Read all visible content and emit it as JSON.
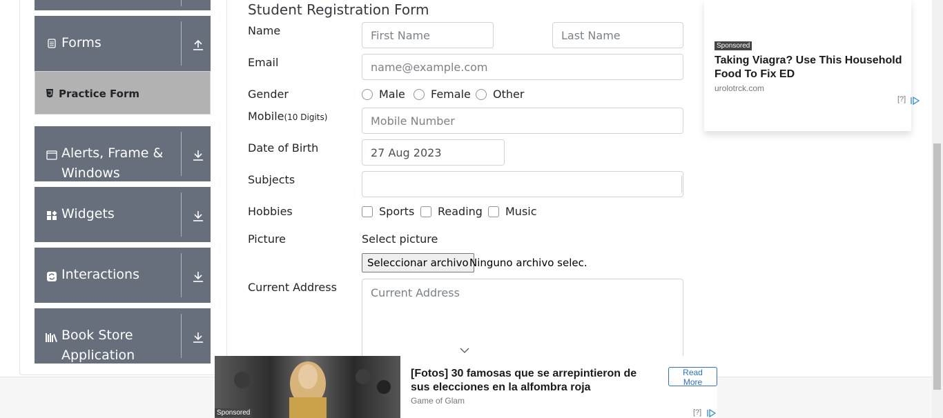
{
  "sidebar": {
    "groups": [
      {
        "title": "Forms"
      },
      {
        "title": "Alerts, Frame &",
        "title2": "Windows"
      },
      {
        "title": "Widgets"
      },
      {
        "title": "Interactions"
      },
      {
        "title": "Book Store",
        "title2": "Application"
      }
    ],
    "active_item": "Practice Form"
  },
  "form": {
    "title": "Student Registration Form",
    "name_label": "Name",
    "first_name_placeholder": "First Name",
    "last_name_placeholder": "Last Name",
    "email_label": "Email",
    "email_placeholder": "name@example.com",
    "gender_label": "Gender",
    "gender_options": [
      "Male",
      "Female",
      "Other"
    ],
    "mobile_label": "Mobile",
    "mobile_hint": "(10 Digits)",
    "mobile_placeholder": "Mobile Number",
    "dob_label": "Date of Birth",
    "dob_value": "27 Aug 2023",
    "subjects_label": "Subjects",
    "hobbies_label": "Hobbies",
    "hobbies_options": [
      "Sports",
      "Reading",
      "Music"
    ],
    "picture_label": "Picture",
    "select_picture": "Select picture",
    "file_button": "Seleccionar archivo",
    "file_status": "Ninguno archivo selec.",
    "address_label": "Current Address",
    "address_placeholder": "Current Address"
  },
  "ad_right": {
    "sponsored": "Sponsored",
    "headline": "Taking Viagra? Use This Household Food To Fix ED",
    "domain": "urolotrck.com",
    "adchoice": "[?]"
  },
  "ad_bottom": {
    "sponsored": "Sponsored",
    "headline": "[Fotos] 30 famosas que se arrepintieron de sus elecciones en la alfombra roja",
    "source": "Game of Glam",
    "read_more": "Read More",
    "adchoice": "[?]"
  },
  "colors": {
    "sidebar_group": "#666f7b",
    "active_item": "#b2b2b2",
    "ad_link": "#2a6fd6"
  }
}
